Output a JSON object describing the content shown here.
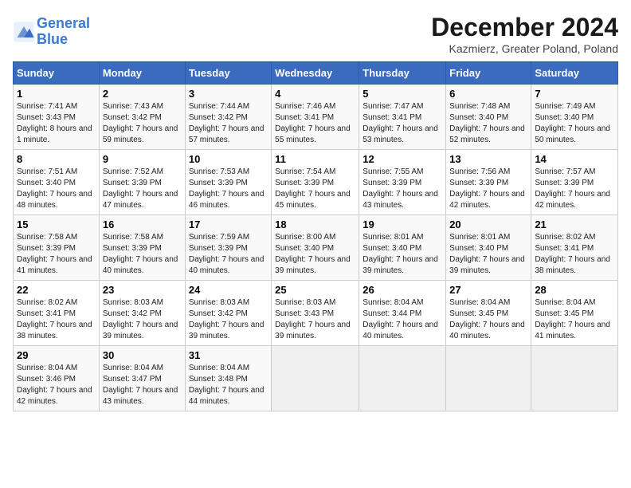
{
  "logo": {
    "line1": "General",
    "line2": "Blue"
  },
  "title": "December 2024",
  "subtitle": "Kazmierz, Greater Poland, Poland",
  "days_header": [
    "Sunday",
    "Monday",
    "Tuesday",
    "Wednesday",
    "Thursday",
    "Friday",
    "Saturday"
  ],
  "weeks": [
    [
      {
        "day": "1",
        "sunrise": "7:41 AM",
        "sunset": "3:43 PM",
        "daylight": "8 hours and 1 minute."
      },
      {
        "day": "2",
        "sunrise": "7:43 AM",
        "sunset": "3:42 PM",
        "daylight": "7 hours and 59 minutes."
      },
      {
        "day": "3",
        "sunrise": "7:44 AM",
        "sunset": "3:42 PM",
        "daylight": "7 hours and 57 minutes."
      },
      {
        "day": "4",
        "sunrise": "7:46 AM",
        "sunset": "3:41 PM",
        "daylight": "7 hours and 55 minutes."
      },
      {
        "day": "5",
        "sunrise": "7:47 AM",
        "sunset": "3:41 PM",
        "daylight": "7 hours and 53 minutes."
      },
      {
        "day": "6",
        "sunrise": "7:48 AM",
        "sunset": "3:40 PM",
        "daylight": "7 hours and 52 minutes."
      },
      {
        "day": "7",
        "sunrise": "7:49 AM",
        "sunset": "3:40 PM",
        "daylight": "7 hours and 50 minutes."
      }
    ],
    [
      {
        "day": "8",
        "sunrise": "7:51 AM",
        "sunset": "3:40 PM",
        "daylight": "7 hours and 48 minutes."
      },
      {
        "day": "9",
        "sunrise": "7:52 AM",
        "sunset": "3:39 PM",
        "daylight": "7 hours and 47 minutes."
      },
      {
        "day": "10",
        "sunrise": "7:53 AM",
        "sunset": "3:39 PM",
        "daylight": "7 hours and 46 minutes."
      },
      {
        "day": "11",
        "sunrise": "7:54 AM",
        "sunset": "3:39 PM",
        "daylight": "7 hours and 45 minutes."
      },
      {
        "day": "12",
        "sunrise": "7:55 AM",
        "sunset": "3:39 PM",
        "daylight": "7 hours and 43 minutes."
      },
      {
        "day": "13",
        "sunrise": "7:56 AM",
        "sunset": "3:39 PM",
        "daylight": "7 hours and 42 minutes."
      },
      {
        "day": "14",
        "sunrise": "7:57 AM",
        "sunset": "3:39 PM",
        "daylight": "7 hours and 42 minutes."
      }
    ],
    [
      {
        "day": "15",
        "sunrise": "7:58 AM",
        "sunset": "3:39 PM",
        "daylight": "7 hours and 41 minutes."
      },
      {
        "day": "16",
        "sunrise": "7:58 AM",
        "sunset": "3:39 PM",
        "daylight": "7 hours and 40 minutes."
      },
      {
        "day": "17",
        "sunrise": "7:59 AM",
        "sunset": "3:39 PM",
        "daylight": "7 hours and 40 minutes."
      },
      {
        "day": "18",
        "sunrise": "8:00 AM",
        "sunset": "3:40 PM",
        "daylight": "7 hours and 39 minutes."
      },
      {
        "day": "19",
        "sunrise": "8:01 AM",
        "sunset": "3:40 PM",
        "daylight": "7 hours and 39 minutes."
      },
      {
        "day": "20",
        "sunrise": "8:01 AM",
        "sunset": "3:40 PM",
        "daylight": "7 hours and 39 minutes."
      },
      {
        "day": "21",
        "sunrise": "8:02 AM",
        "sunset": "3:41 PM",
        "daylight": "7 hours and 38 minutes."
      }
    ],
    [
      {
        "day": "22",
        "sunrise": "8:02 AM",
        "sunset": "3:41 PM",
        "daylight": "7 hours and 38 minutes."
      },
      {
        "day": "23",
        "sunrise": "8:03 AM",
        "sunset": "3:42 PM",
        "daylight": "7 hours and 39 minutes."
      },
      {
        "day": "24",
        "sunrise": "8:03 AM",
        "sunset": "3:42 PM",
        "daylight": "7 hours and 39 minutes."
      },
      {
        "day": "25",
        "sunrise": "8:03 AM",
        "sunset": "3:43 PM",
        "daylight": "7 hours and 39 minutes."
      },
      {
        "day": "26",
        "sunrise": "8:04 AM",
        "sunset": "3:44 PM",
        "daylight": "7 hours and 40 minutes."
      },
      {
        "day": "27",
        "sunrise": "8:04 AM",
        "sunset": "3:45 PM",
        "daylight": "7 hours and 40 minutes."
      },
      {
        "day": "28",
        "sunrise": "8:04 AM",
        "sunset": "3:45 PM",
        "daylight": "7 hours and 41 minutes."
      }
    ],
    [
      {
        "day": "29",
        "sunrise": "8:04 AM",
        "sunset": "3:46 PM",
        "daylight": "7 hours and 42 minutes."
      },
      {
        "day": "30",
        "sunrise": "8:04 AM",
        "sunset": "3:47 PM",
        "daylight": "7 hours and 43 minutes."
      },
      {
        "day": "31",
        "sunrise": "8:04 AM",
        "sunset": "3:48 PM",
        "daylight": "7 hours and 44 minutes."
      },
      null,
      null,
      null,
      null
    ]
  ]
}
